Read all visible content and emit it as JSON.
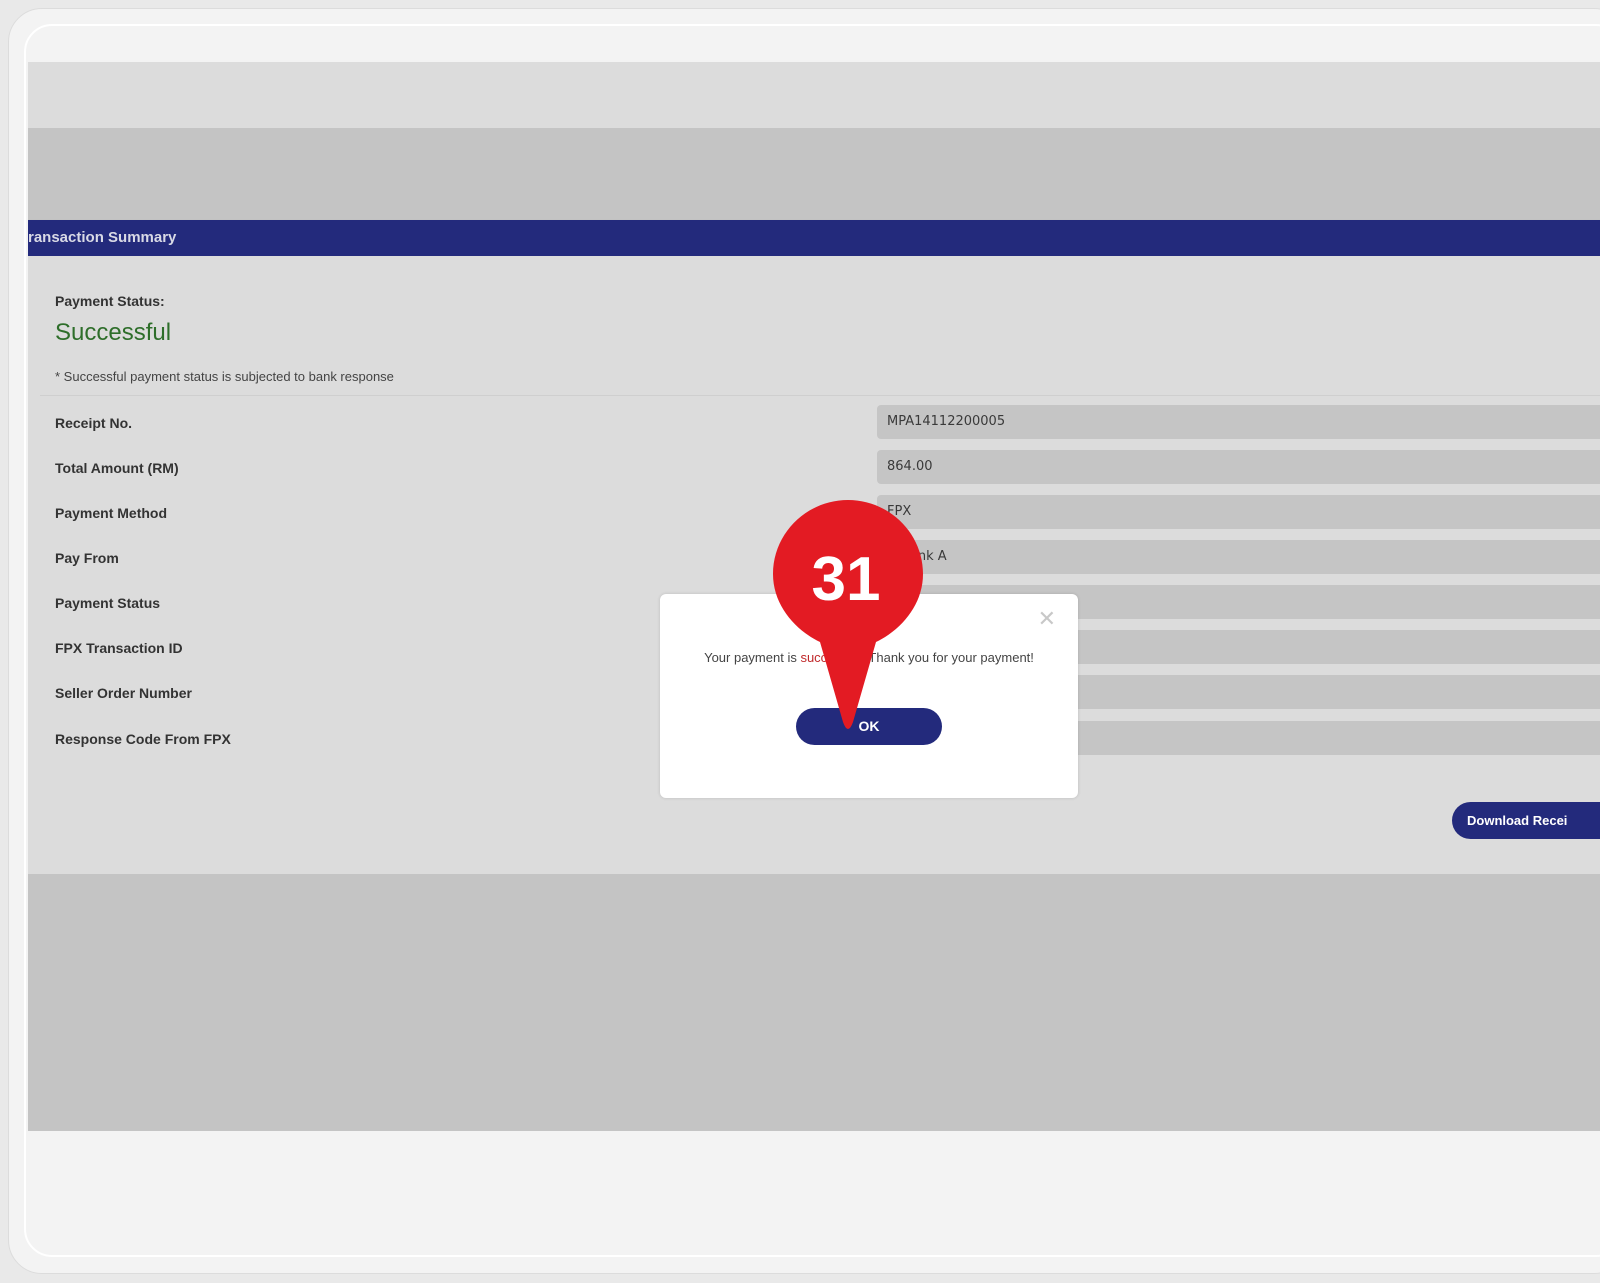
{
  "panel": {
    "header": "ransaction Summary",
    "status_label": "Payment Status:",
    "status_value": "Successful",
    "status_note": "* Successful payment status is subjected to bank response"
  },
  "rows": [
    {
      "label": "Receipt No.",
      "value": "MPA14112200005"
    },
    {
      "label": "Total Amount (RM)",
      "value": "864.00"
    },
    {
      "label": "Payment Method",
      "value": "FPX"
    },
    {
      "label": "Pay From",
      "value": "Bank A"
    },
    {
      "label": "Payment Status",
      "value": ""
    },
    {
      "label": "FPX Transaction ID",
      "value": ""
    },
    {
      "label": "Seller Order Number",
      "value": ""
    },
    {
      "label": "Response Code From FPX",
      "value": ""
    }
  ],
  "download_button": "Download Recei",
  "modal": {
    "message_before": "Your payment is ",
    "message_highlight": "succe",
    "message_after": "Thank you for your payment!",
    "ok_label": "OK",
    "close_glyph": "✕"
  },
  "step_marker": {
    "number": "31",
    "color": "#e31b23"
  }
}
